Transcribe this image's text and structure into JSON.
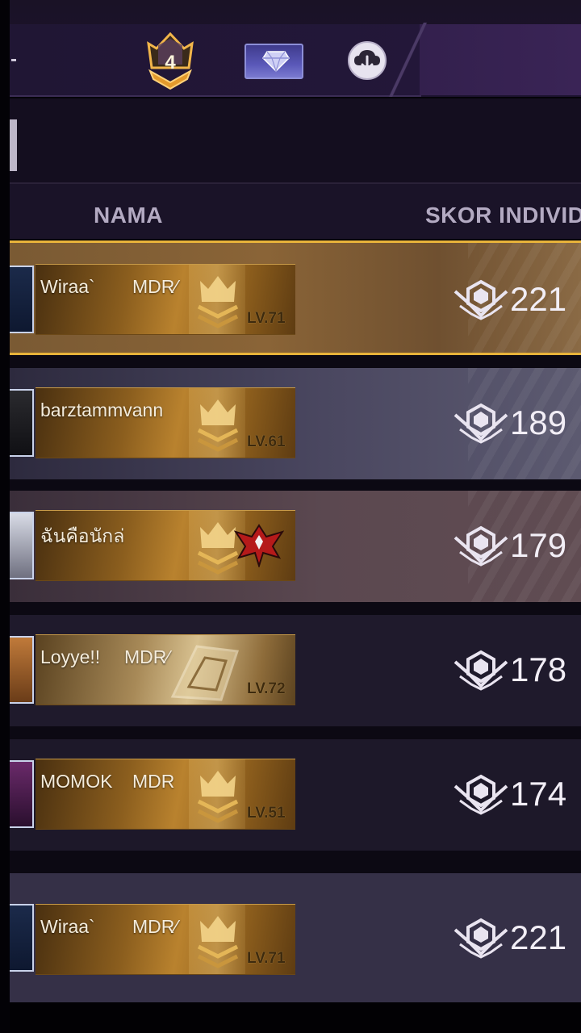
{
  "topbar": {
    "rank_number": "4"
  },
  "header": {
    "name_col": "NAMA",
    "score_col": "SKOR INDIVIDU"
  },
  "rows": [
    {
      "name": "Wiraa`",
      "tag": "MDR⁄",
      "level": "LV.71",
      "score": "221"
    },
    {
      "name": "barztammvann",
      "tag": "",
      "level": "LV.61",
      "score": "189"
    },
    {
      "name": "ฉันคือนักล่",
      "tag": "",
      "level": "",
      "score": "179"
    },
    {
      "name": "Loyye!!",
      "tag": "MDR⁄",
      "level": "LV.72",
      "score": "178"
    },
    {
      "name": "MOMOK",
      "tag": "MDR",
      "level": "LV.51",
      "score": "174"
    },
    {
      "name": "Wiraa`",
      "tag": "MDR⁄",
      "level": "LV.71",
      "score": "221"
    }
  ],
  "icons": {
    "rank": "rank-crown-icon",
    "diamond": "diamond-card-icon",
    "download": "cloud-download-icon",
    "score": "score-emblem-icon",
    "crown": "crown-badge-icon",
    "elite": "eagle-emblem-icon"
  },
  "colors": {
    "gold_accent": "#e8b33a",
    "background": "#05040a"
  }
}
